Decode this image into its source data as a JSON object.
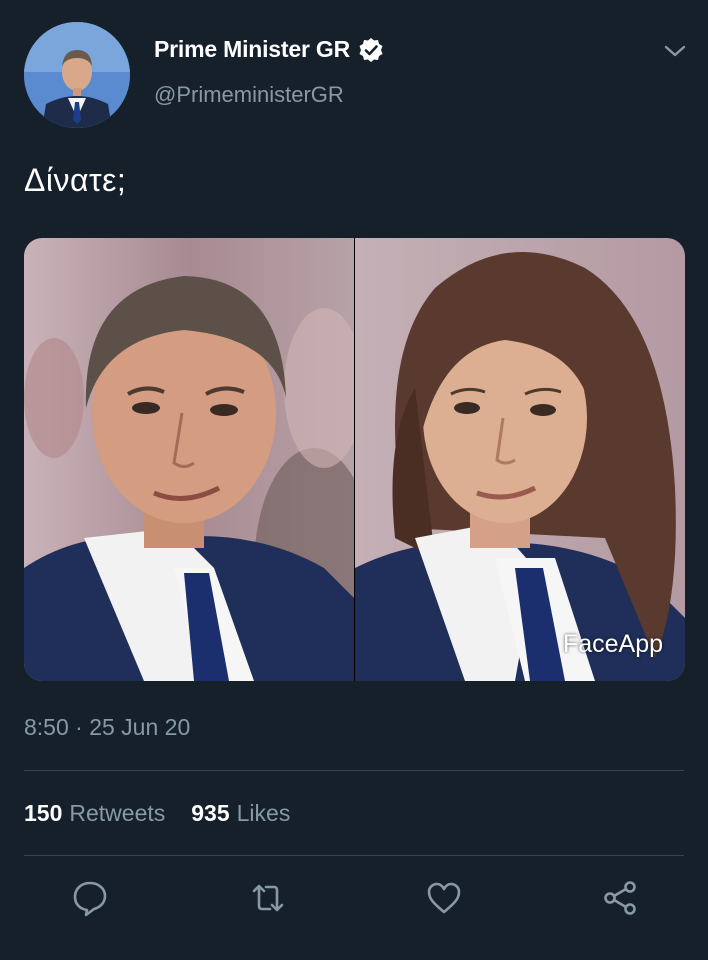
{
  "account": {
    "display_name": "Prime Minister GR",
    "handle": "@PrimeministerGR",
    "verified": true
  },
  "tweet": {
    "text": "Δίνατε;",
    "timestamp": "8:50 · 25 Jun 20",
    "media_watermark": "FaceApp"
  },
  "stats": {
    "retweets_count": "150",
    "retweets_label": "Retweets",
    "likes_count": "935",
    "likes_label": "Likes"
  },
  "icons": {
    "reply": "reply-icon",
    "retweet": "retweet-icon",
    "like": "like-icon",
    "share": "share-icon",
    "verified": "verified-badge-icon",
    "menu": "chevron-down-icon"
  },
  "colors": {
    "background": "#15202b",
    "secondary_text": "#8899a6",
    "divider": "#38444d"
  }
}
